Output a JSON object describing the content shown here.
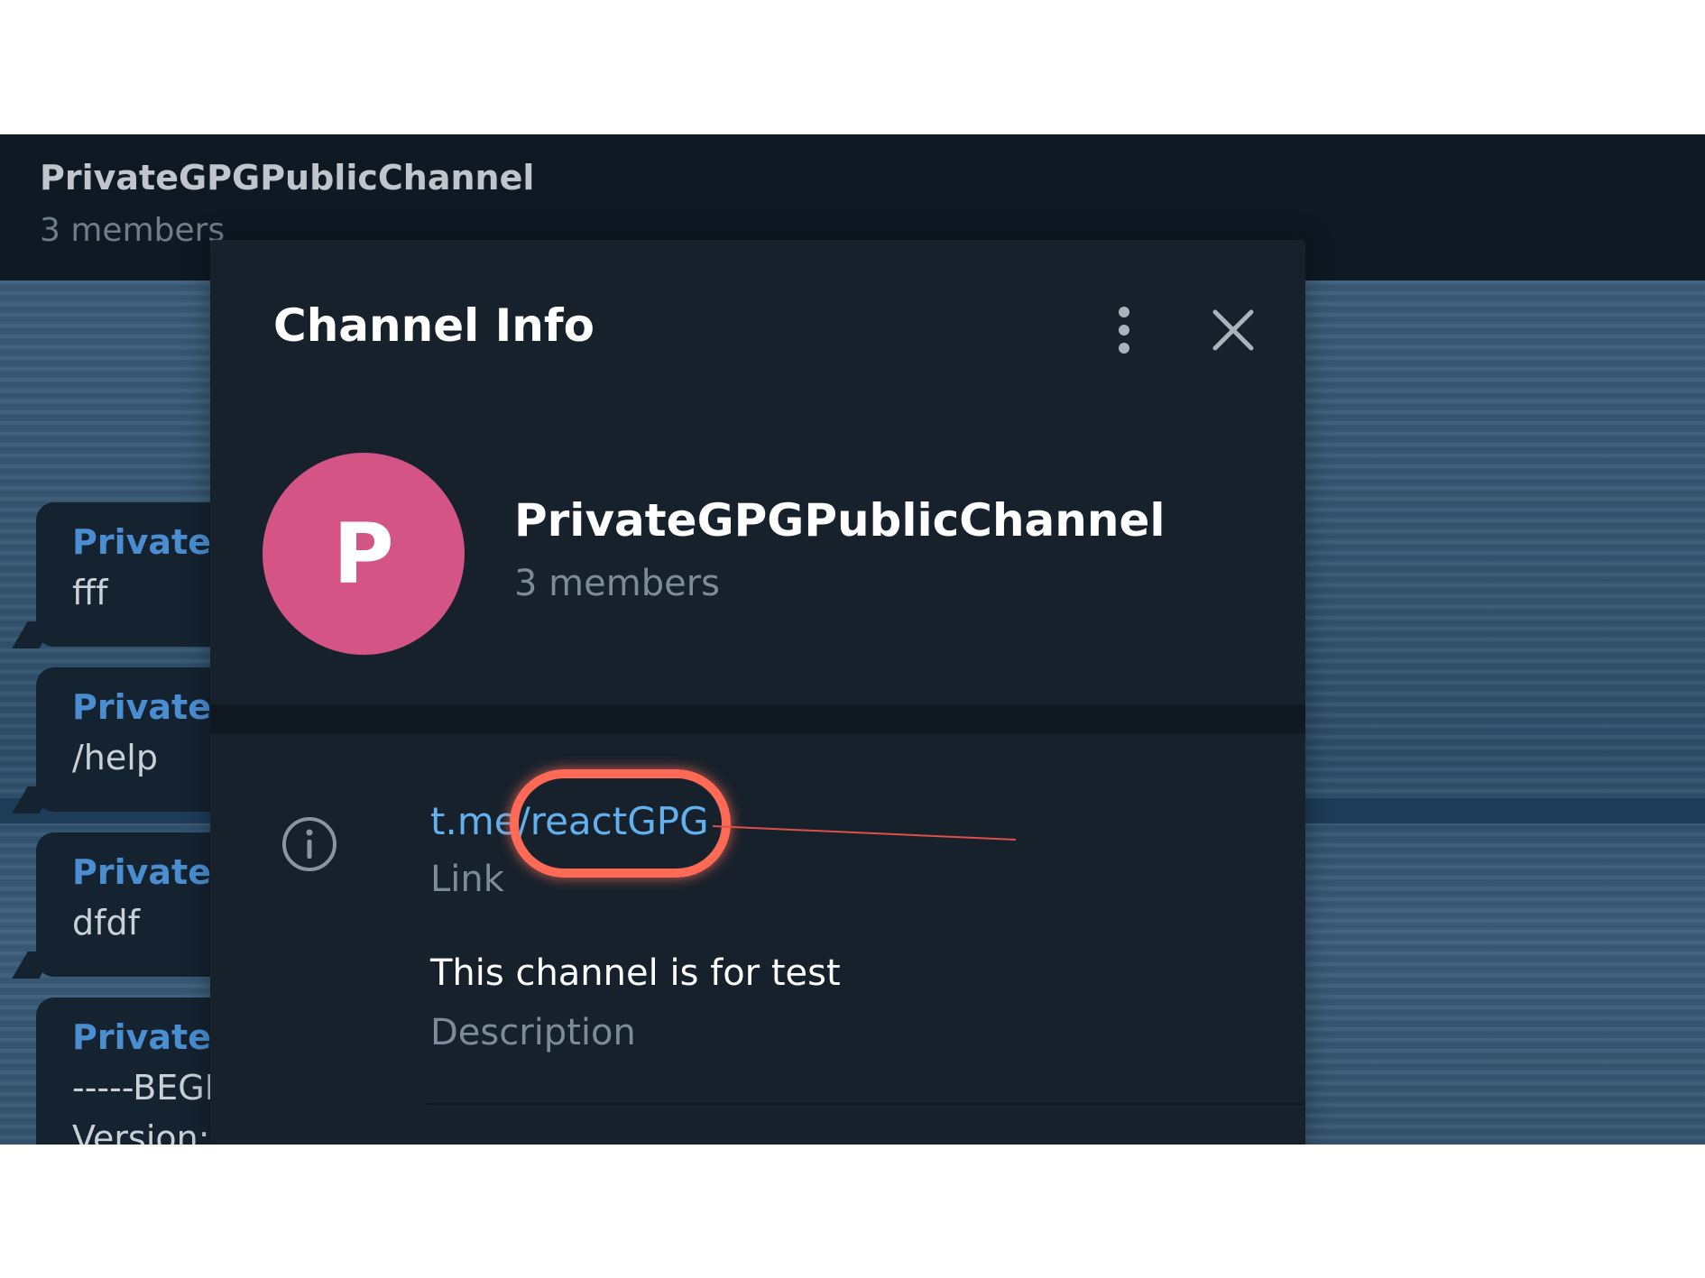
{
  "chat": {
    "title": "PrivateGPGPublicChannel",
    "subtitle": "3 members",
    "messages": [
      {
        "sender": "PrivateG",
        "text": "fff"
      },
      {
        "sender": "PrivateG",
        "text": "/help"
      },
      {
        "sender": "PrivateG",
        "text": "dfdf"
      },
      {
        "sender": "PrivateG",
        "text": "-----BEGI",
        "text2": "Version:"
      }
    ]
  },
  "panel": {
    "title": "Channel Info",
    "avatar_letter": "P",
    "avatar_color": "#d45485",
    "name": "PrivateGPGPublicChannel",
    "members": "3 members",
    "link": "t.me/reactGPG",
    "link_label": "Link",
    "description": "This channel is for test",
    "description_label": "Description",
    "icons": [
      "more-vertical-icon",
      "close-icon",
      "info-icon"
    ]
  },
  "colors": {
    "link": "#62b0ee",
    "highlight": "#ff6a57",
    "panel_bg": "#17212b"
  }
}
